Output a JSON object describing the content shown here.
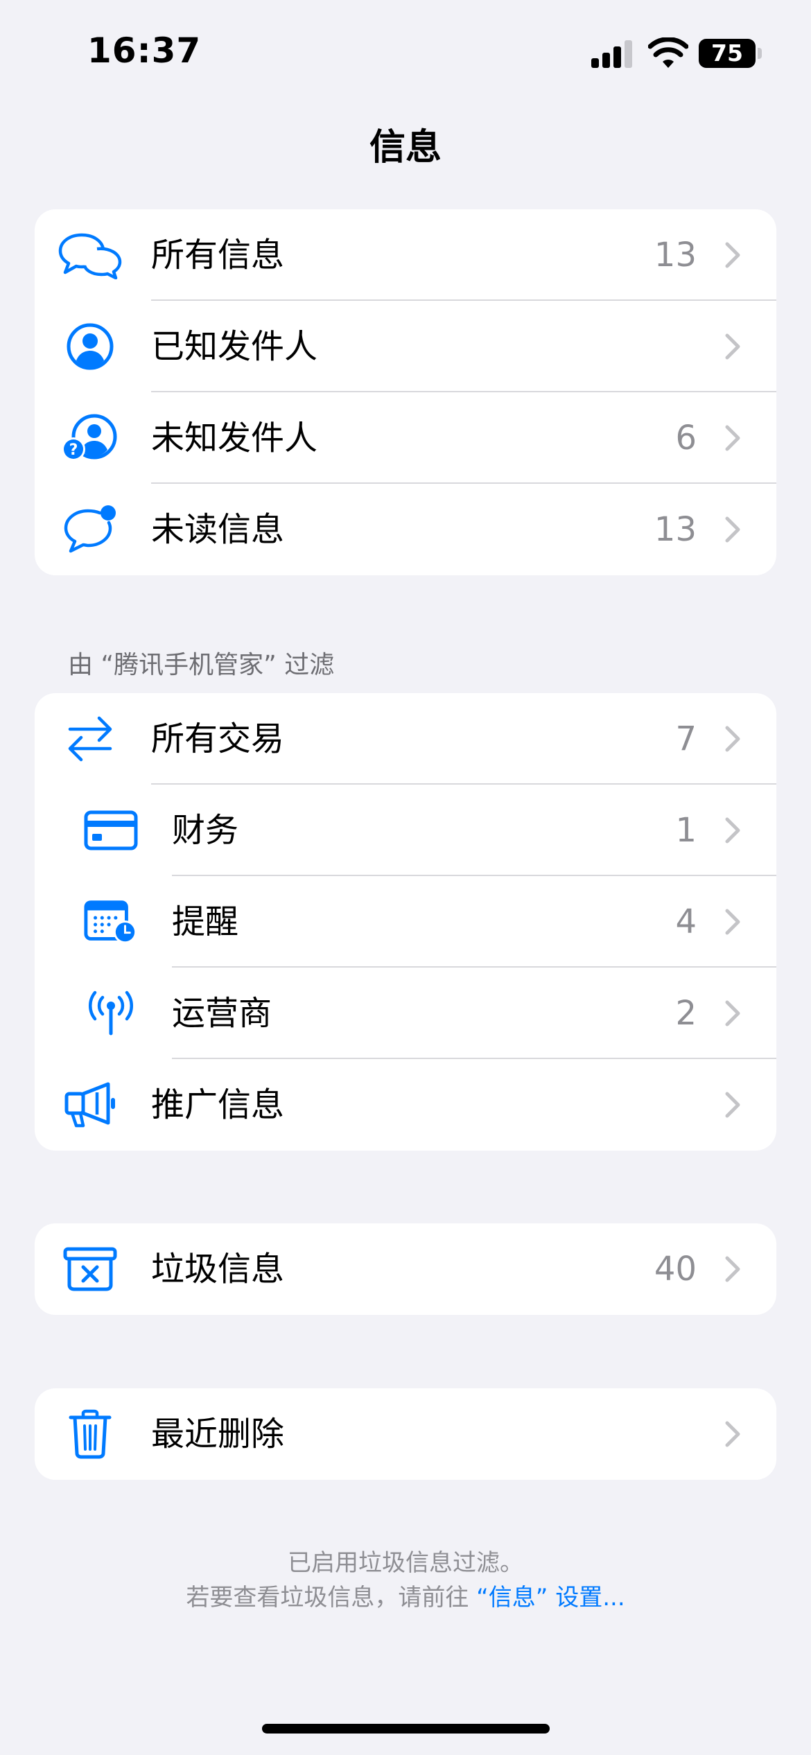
{
  "status_bar": {
    "time": "16:37",
    "battery": "75"
  },
  "nav": {
    "title": "信息"
  },
  "group1": {
    "rows": [
      {
        "label": "所有信息",
        "count": "13",
        "icon": "message-bubbles-icon"
      },
      {
        "label": "已知发件人",
        "count": "",
        "icon": "person-circle-icon"
      },
      {
        "label": "未知发件人",
        "count": "6",
        "icon": "person-question-icon"
      },
      {
        "label": "未读信息",
        "count": "13",
        "icon": "message-unread-icon"
      }
    ]
  },
  "filter_section": {
    "header": "由 “腾讯手机管家” 过滤",
    "rows": [
      {
        "label": "所有交易",
        "count": "7",
        "icon": "arrows-swap-icon"
      },
      {
        "label": "财务",
        "count": "1",
        "icon": "credit-card-icon"
      },
      {
        "label": "提醒",
        "count": "4",
        "icon": "calendar-clock-icon"
      },
      {
        "label": "运营商",
        "count": "2",
        "icon": "antenna-icon"
      },
      {
        "label": "推广信息",
        "count": "",
        "icon": "megaphone-icon"
      }
    ]
  },
  "junk": {
    "label": "垃圾信息",
    "count": "40",
    "icon": "junk-box-icon"
  },
  "deleted": {
    "label": "最近删除",
    "count": "",
    "icon": "trash-icon"
  },
  "footer": {
    "line1": "已启用垃圾信息过滤。",
    "line2_prefix": "若要查看垃圾信息，请前往 ",
    "line2_link": "“信息” 设置..."
  },
  "colors": {
    "accent": "#007aff",
    "background": "#f2f2f7"
  }
}
